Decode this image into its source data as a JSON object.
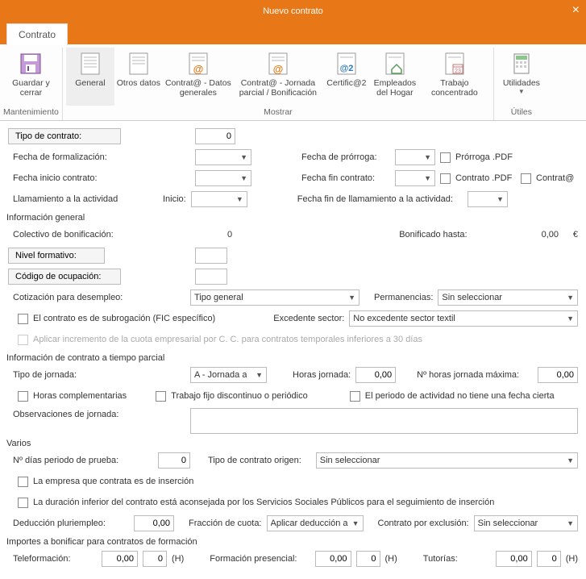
{
  "window": {
    "title": "Nuevo contrato"
  },
  "tab": {
    "label": "Contrato"
  },
  "ribbon": {
    "groups": {
      "mantenimiento": {
        "label": "Mantenimiento",
        "items": {
          "guardar": "Guardar y cerrar"
        }
      },
      "mostrar": {
        "label": "Mostrar",
        "items": {
          "general": "General",
          "otros": "Otros datos",
          "contrata": "Contrat@ - Datos generales",
          "jornada": "Contrat@ - Jornada parcial / Bonificación",
          "certific": "Certific@2",
          "empleados": "Empleados del Hogar",
          "trabajo": "Trabajo concentrado"
        }
      },
      "utiles": {
        "label": "Útiles",
        "items": {
          "utilidades": "Utilidades"
        }
      }
    }
  },
  "form": {
    "tipo_contrato_lbl": "Tipo de contrato:",
    "tipo_contrato_val": "0",
    "fecha_formalizacion_lbl": "Fecha de formalización:",
    "fecha_prorroga_lbl": "Fecha de prórroga:",
    "prorroga_pdf_lbl": "Prórroga .PDF",
    "fecha_inicio_lbl": "Fecha inicio contrato:",
    "fecha_fin_lbl": "Fecha fin contrato:",
    "contrato_pdf_lbl": "Contrato .PDF",
    "contrata_lbl": "Contrat@",
    "llamamiento_lbl": "Llamamiento a la actividad",
    "inicio_lbl": "Inicio:",
    "fecha_fin_llam_lbl": "Fecha fin de llamamiento a la actividad:",
    "sec_info_general": "Información general",
    "colectivo_lbl": "Colectivo de bonificación:",
    "colectivo_val": "0",
    "bonificado_lbl": "Bonificado hasta:",
    "bonificado_val": "0,00",
    "euro": "€",
    "nivel_formativo_lbl": "Nivel formativo:",
    "codigo_ocupacion_lbl": "Código de ocupación:",
    "cotizacion_lbl": "Cotización para desempleo:",
    "cotizacion_val": "Tipo general",
    "permanencias_lbl": "Permanencias:",
    "permanencias_val": "Sin seleccionar",
    "subrogacion_lbl": "El contrato es de subrogación (FIC específico)",
    "excedente_lbl": "Excedente sector:",
    "excedente_val": "No excedente sector textil",
    "aplicar_incremento_lbl": "Aplicar incremento de la cuota empresarial por C. C. para contratos temporales inferiores a 30 días",
    "sec_tiempo_parcial": "Información de contrato a tiempo parcial",
    "tipo_jornada_lbl": "Tipo de jornada:",
    "tipo_jornada_val": "A - Jornada a",
    "horas_jornada_lbl": "Horas jornada:",
    "horas_jornada_val": "0,00",
    "n_horas_max_lbl": "Nº horas jornada máxima:",
    "n_horas_max_val": "0,00",
    "horas_compl_lbl": "Horas complementarias",
    "trabajo_fijo_lbl": "Trabajo fijo discontinuo o periódico",
    "periodo_sin_fecha_lbl": "El periodo de actividad no tiene una fecha cierta",
    "observaciones_lbl": "Observaciones de jornada:",
    "sec_varios": "Varios",
    "dias_prueba_lbl": "Nº días periodo de prueba:",
    "dias_prueba_val": "0",
    "tipo_origen_lbl": "Tipo de contrato origen:",
    "tipo_origen_val": "Sin seleccionar",
    "empresa_insercion_lbl": "La empresa que contrata es de inserción",
    "duracion_inferior_lbl": "La duración inferior del contrato está aconsejada por los Servicios Sociales Públicos para el seguimiento de inserción",
    "deduccion_lbl": "Deducción pluriempleo:",
    "deduccion_val": "0,00",
    "fraccion_lbl": "Fracción de cuota:",
    "fraccion_val": "Aplicar deducción a",
    "contrato_excl_lbl": "Contrato por exclusión:",
    "contrato_excl_val": "Sin seleccionar",
    "sec_importes": "Importes a bonificar para contratos de formación",
    "teleformacion_lbl": "Teleformación:",
    "formacion_presencial_lbl": "Formación presencial:",
    "tutorias_lbl": "Tutorías:",
    "zero_dec": "0,00",
    "zero_int": "0",
    "h_suffix": "(H)"
  }
}
